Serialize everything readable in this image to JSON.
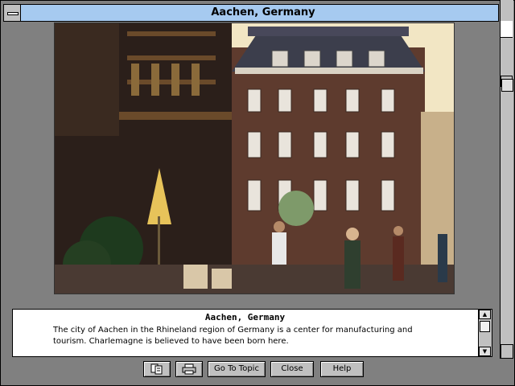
{
  "window": {
    "title": "Aachen, Germany"
  },
  "photo": {
    "subject": "Aachen town square with cafe terrace, brick hotel building and pedestrians"
  },
  "caption": {
    "title": "Aachen, Germany",
    "body": "The city of Aachen in the Rhineland region of Germany is a center for manufacturing and tourism. Charlemagne is believed to have been born here."
  },
  "buttons": {
    "copy_icon": "copy-icon",
    "print_icon": "printer-icon",
    "go_to_topic": "Go To Topic",
    "close": "Close",
    "help": "Help"
  },
  "colors": {
    "titlebar": "#a6caf0",
    "background": "#808080",
    "button_face": "#c0c0c0"
  }
}
